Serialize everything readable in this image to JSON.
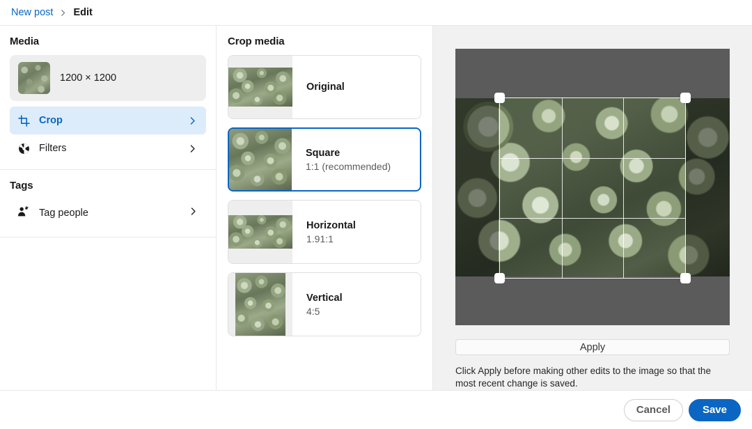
{
  "header": {
    "breadcrumb_root": "New post",
    "breadcrumb_separator": "chevron-right-icon",
    "breadcrumb_current": "Edit"
  },
  "sidebar": {
    "media_section_title": "Media",
    "media_dimensions": "1200 × 1200",
    "items": [
      {
        "label": "Crop",
        "icon": "crop-icon",
        "selected": true
      },
      {
        "label": "Filters",
        "icon": "aperture-icon",
        "selected": false
      }
    ],
    "tags_section_title": "Tags",
    "tag_people_label": "Tag people",
    "tag_people_icon": "person-add-icon"
  },
  "crop_panel": {
    "title": "Crop media",
    "options": [
      {
        "name": "Original",
        "ratio": "",
        "selected": false,
        "fit": "letterbox-horizontal"
      },
      {
        "name": "Square",
        "ratio": "1:1 (recommended)",
        "selected": true,
        "fit": "fill"
      },
      {
        "name": "Horizontal",
        "ratio": "1.91:1",
        "selected": false,
        "fit": "letterbox-wide"
      },
      {
        "name": "Vertical",
        "ratio": "4:5",
        "selected": false,
        "fit": "pillarbox"
      }
    ]
  },
  "preview": {
    "apply_label": "Apply",
    "hint": "Click Apply before making other edits to the image so that the most recent change is saved.",
    "canvas_background": "#5b5b5b",
    "crop_overlay": {
      "grid": "rule-of-thirds",
      "handles": [
        "top-left",
        "top-right",
        "bottom-left",
        "bottom-right"
      ]
    }
  },
  "footer": {
    "cancel_label": "Cancel",
    "save_label": "Save"
  },
  "colors": {
    "accent": "#0a66c2",
    "selected_row_bg": "#dcecfb",
    "panel_bg": "#f1f1f1",
    "card_bg": "#eeeeee"
  }
}
